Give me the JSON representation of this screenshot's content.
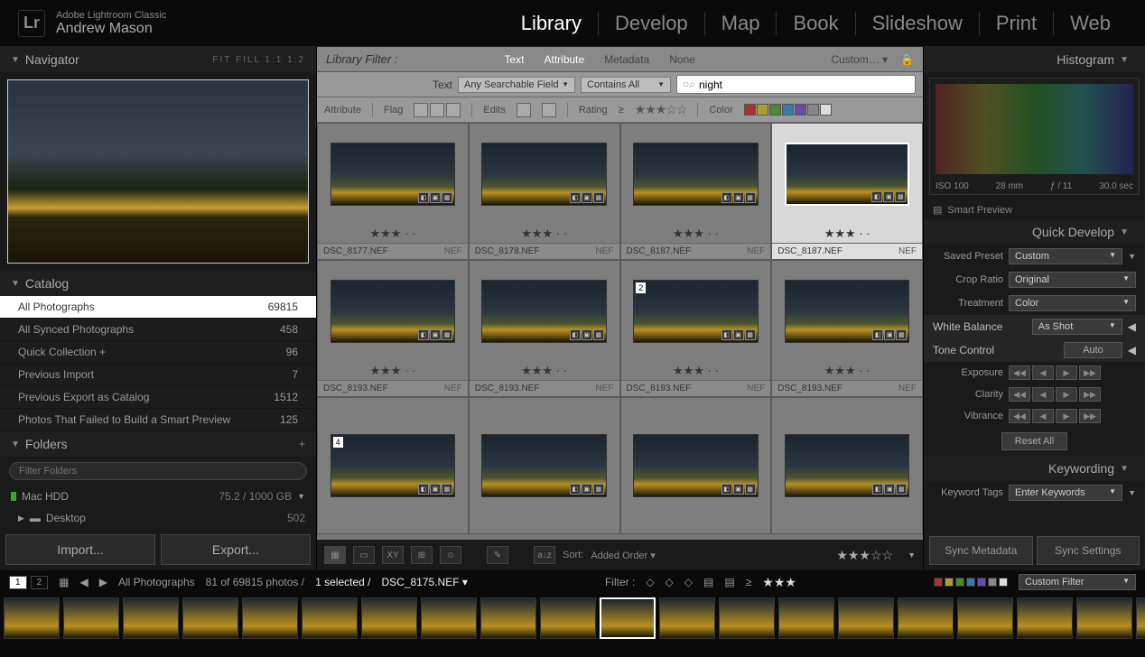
{
  "app": {
    "name": "Adobe Lightroom Classic",
    "user": "Andrew Mason",
    "logo": "Lr"
  },
  "modules": [
    "Library",
    "Develop",
    "Map",
    "Book",
    "Slideshow",
    "Print",
    "Web"
  ],
  "active_module": "Library",
  "navigator": {
    "title": "Navigator",
    "modes": "FIT   FILL   1:1   1:2"
  },
  "catalog": {
    "title": "Catalog",
    "items": [
      {
        "label": "All Photographs",
        "count": "69815",
        "sel": true
      },
      {
        "label": "All Synced Photographs",
        "count": "458"
      },
      {
        "label": "Quick Collection  +",
        "count": "96"
      },
      {
        "label": "Previous Import",
        "count": "7"
      },
      {
        "label": "Previous Export as Catalog",
        "count": "1512"
      },
      {
        "label": "Photos That Failed to Build a Smart Preview",
        "count": "125"
      }
    ]
  },
  "folders": {
    "title": "Folders",
    "filter_placeholder": "Filter Folders",
    "volumes": [
      {
        "name": "Mac HDD",
        "space": "75.2 / 1000 GB"
      }
    ],
    "items": [
      {
        "name": "Desktop",
        "count": "502"
      }
    ]
  },
  "buttons": {
    "import": "Import...",
    "export": "Export..."
  },
  "libfilter": {
    "label": "Library Filter :",
    "tabs": [
      "Text",
      "Attribute",
      "Metadata",
      "None"
    ],
    "active": [
      "Text",
      "Attribute"
    ],
    "preset": "Custom…",
    "text_label": "Text",
    "field": "Any Searchable Field",
    "rule": "Contains All",
    "query": "night",
    "attr_label": "Attribute",
    "flag_label": "Flag",
    "edits_label": "Edits",
    "rating_label": "Rating",
    "color_label": "Color",
    "colors": [
      "#a83232",
      "#a8a032",
      "#4a8a32",
      "#3a7aa8",
      "#6a4aa8",
      "#888",
      "#ddd"
    ]
  },
  "grid": [
    {
      "file": "DSC_8177.NEF",
      "ext": "NEF",
      "stars": 3,
      "sel": false
    },
    {
      "file": "DSC_8178.NEF",
      "ext": "NEF",
      "stars": 3,
      "sel": false
    },
    {
      "file": "DSC_8187.NEF",
      "ext": "NEF",
      "stars": 3,
      "sel": false
    },
    {
      "file": "DSC_8187.NEF",
      "ext": "NEF",
      "stars": 3,
      "sel": true
    },
    {
      "file": "DSC_8193.NEF",
      "ext": "NEF",
      "stars": 3,
      "sel": false
    },
    {
      "file": "DSC_8193.NEF",
      "ext": "NEF",
      "stars": 3,
      "sel": false
    },
    {
      "file": "DSC_8193.NEF",
      "ext": "NEF",
      "stars": 3,
      "badge": "2",
      "sel": false
    },
    {
      "file": "DSC_8193.NEF",
      "ext": "NEF",
      "stars": 3,
      "sel": false
    }
  ],
  "grid_row3": [
    {
      "badge": "4"
    },
    {
      "badge": ""
    },
    {
      "badge": ""
    },
    {
      "badge": ""
    }
  ],
  "toolbar": {
    "sort_label": "Sort:",
    "sort_value": "Added Order"
  },
  "histogram": {
    "title": "Histogram",
    "iso": "ISO 100",
    "focal": "28 mm",
    "aperture": "ƒ / 11",
    "shutter": "30.0 sec",
    "smart": "Smart Preview"
  },
  "quickdev": {
    "title": "Quick Develop",
    "preset_label": "Saved Preset",
    "preset": "Custom",
    "crop_label": "Crop Ratio",
    "crop": "Original",
    "treat_label": "Treatment",
    "treat": "Color",
    "wb_label": "White Balance",
    "wb": "As Shot",
    "tone_label": "Tone Control",
    "auto": "Auto",
    "sliders": [
      "Exposure",
      "Clarity",
      "Vibrance"
    ],
    "reset": "Reset All"
  },
  "keywording": {
    "title": "Keywording",
    "tags_label": "Keyword Tags",
    "tags": "Enter Keywords"
  },
  "sync": {
    "meta": "Sync Metadata",
    "settings": "Sync Settings"
  },
  "info": {
    "source": "All Photographs",
    "count": "81 of 69815 photos /",
    "sel": "1 selected /",
    "file": "DSC_8175.NEF",
    "filter_label": "Filter :",
    "preset": "Custom Filter",
    "colors": [
      "#a83232",
      "#a8a032",
      "#4a8a32",
      "#3a7aa8",
      "#6a4aa8",
      "#888",
      "#ddd"
    ]
  }
}
